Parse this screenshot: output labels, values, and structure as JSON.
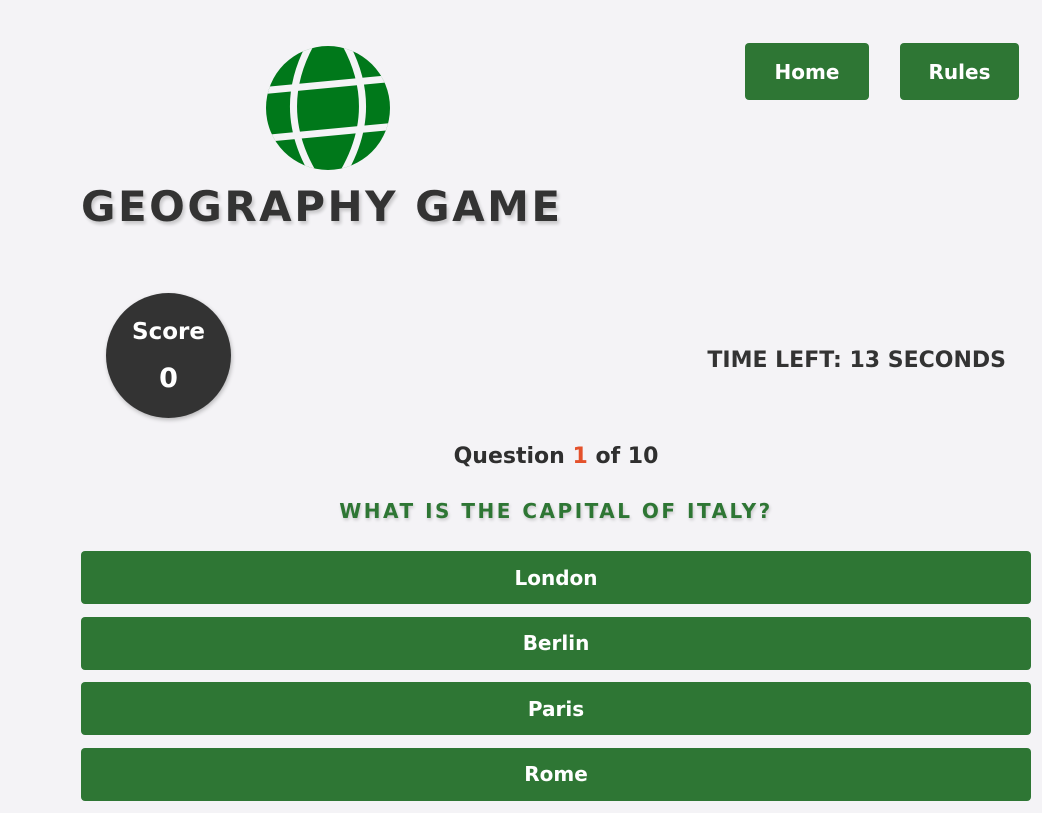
{
  "nav": {
    "home_label": "Home",
    "rules_label": "Rules"
  },
  "logo": {
    "icon": "globe-icon",
    "color": "#00781a"
  },
  "header": {
    "title": "GEOGRAPHY GAME"
  },
  "score": {
    "label": "Score",
    "value": "0"
  },
  "timer": {
    "text": "TIME LEFT: 13 SECONDS"
  },
  "progress": {
    "prefix": "Question",
    "current": "1",
    "suffix": "of 10"
  },
  "question": {
    "text": "WHAT IS THE CAPITAL OF ITALY?"
  },
  "answers": [
    {
      "label": "London"
    },
    {
      "label": "Berlin"
    },
    {
      "label": "Paris"
    },
    {
      "label": "Rome"
    }
  ],
  "colors": {
    "background": "#f4f3f6",
    "button": "#2e7634",
    "accent": "#e4512b",
    "dark": "#333333"
  }
}
